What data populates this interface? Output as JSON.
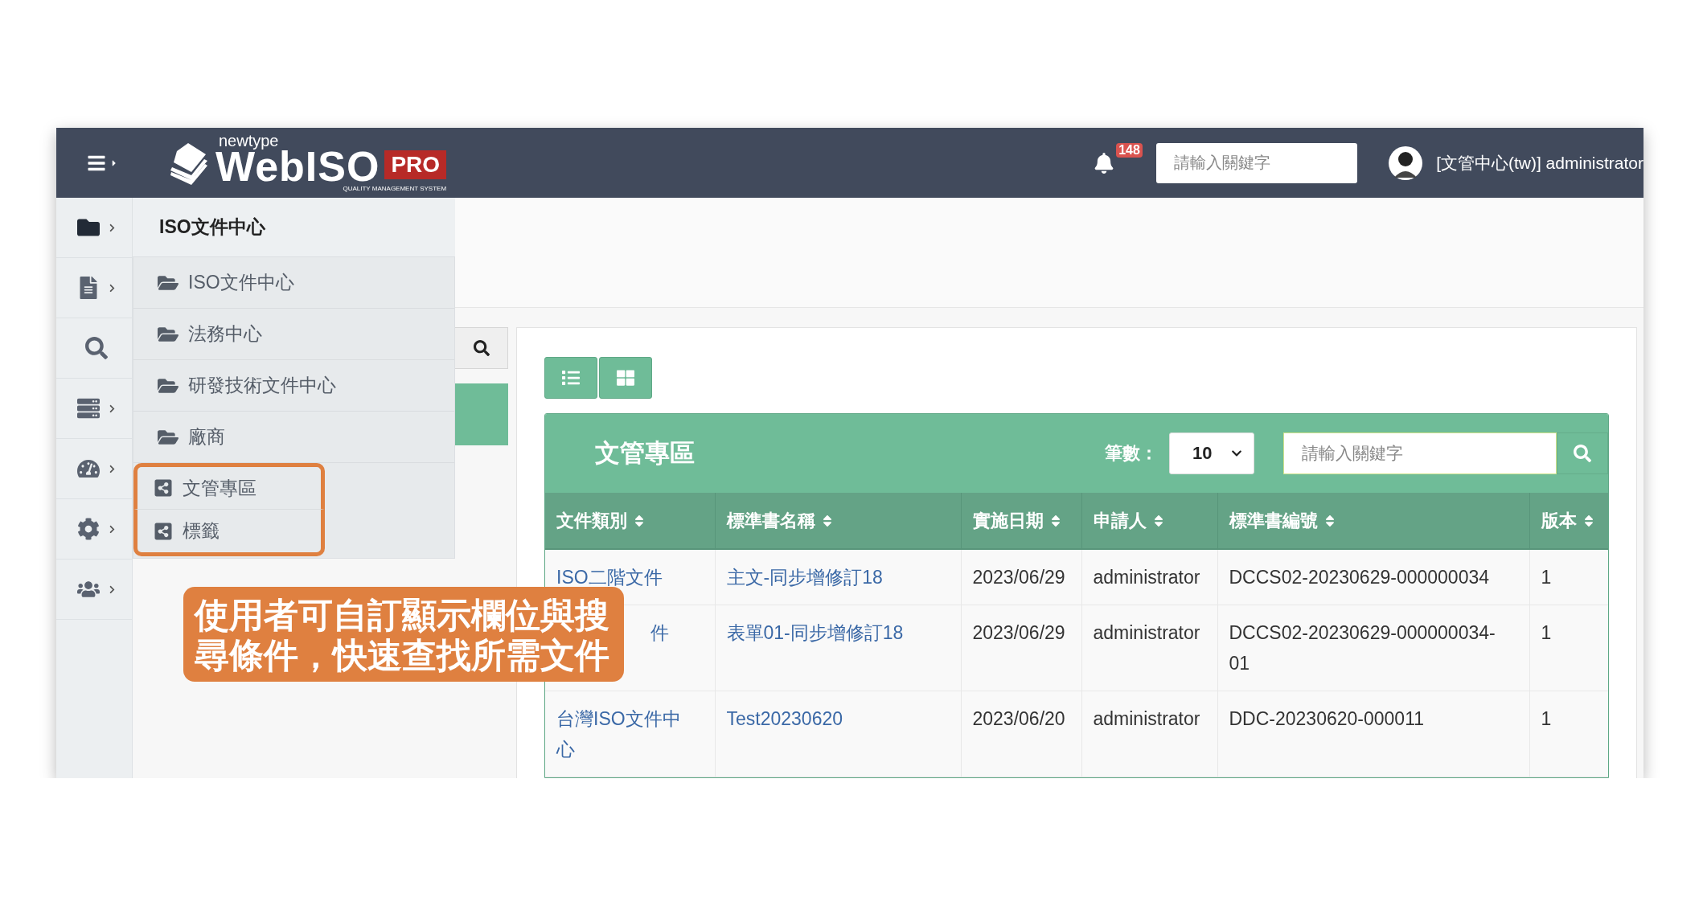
{
  "logo": {
    "small": "newtype",
    "main": "WebISO",
    "badge": "PRO",
    "tagline": "QUALITY MANAGEMENT SYSTEM"
  },
  "notifications": {
    "count": "148"
  },
  "search": {
    "placeholder": "請輸入關鍵字"
  },
  "user": {
    "label": "[文管中心(tw)] administrator"
  },
  "rail": [
    {
      "kind": "folder",
      "chevron": true,
      "selected": true
    },
    {
      "kind": "file",
      "chevron": true,
      "selected": false
    },
    {
      "kind": "search",
      "chevron": false,
      "selected": false
    },
    {
      "kind": "server",
      "chevron": true,
      "selected": false
    },
    {
      "kind": "dashboard",
      "chevron": true,
      "selected": false
    },
    {
      "kind": "settings",
      "chevron": true,
      "selected": false
    },
    {
      "kind": "users",
      "chevron": true,
      "selected": false
    }
  ],
  "menu": {
    "title": "ISO文件中心",
    "items": [
      {
        "label": "ISO文件中心",
        "kind": "folder",
        "highlighted": false
      },
      {
        "label": "法務中心",
        "kind": "folder",
        "highlighted": false
      },
      {
        "label": "研發技術文件中心",
        "kind": "folder",
        "highlighted": false
      },
      {
        "label": "廠商",
        "kind": "folder",
        "highlighted": false
      },
      {
        "label": "文管專區",
        "kind": "share",
        "highlighted": true
      },
      {
        "label": "標籤",
        "kind": "share",
        "highlighted": true
      }
    ]
  },
  "callout": {
    "text": "使用者可自訂顯示欄位與搜尋條件，快速查找所需文件"
  },
  "view_buttons": [
    {
      "kind": "list"
    },
    {
      "kind": "grid"
    }
  ],
  "panel": {
    "title": "文管專區",
    "count_label": "筆數：",
    "page_size": "10",
    "search_placeholder": "請輸入關鍵字"
  },
  "table": {
    "columns": [
      {
        "label": "文件類別",
        "kind": "link"
      },
      {
        "label": "標準書名稱",
        "kind": "link"
      },
      {
        "label": "實施日期",
        "kind": "text"
      },
      {
        "label": "申請人",
        "kind": "text"
      },
      {
        "label": "標準書編號",
        "kind": "text"
      },
      {
        "label": "版本",
        "kind": "text"
      }
    ],
    "rows": [
      {
        "cells": [
          {
            "text": "ISO二階文件",
            "partly_hidden": false
          },
          {
            "text": "主文-同步增修訂18",
            "partly_hidden": false
          },
          {
            "text": "2023/06/29",
            "partly_hidden": false
          },
          {
            "text": "administrator",
            "partly_hidden": false
          },
          {
            "text": "DCCS02-20230629-000000034",
            "partly_hidden": false
          },
          {
            "text": "1",
            "partly_hidden": false
          }
        ]
      },
      {
        "cells": [
          {
            "text": "件",
            "partly_hidden": true
          },
          {
            "text": "表單01-同步增修訂18",
            "partly_hidden": false
          },
          {
            "text": "2023/06/29",
            "partly_hidden": false
          },
          {
            "text": "administrator",
            "partly_hidden": false
          },
          {
            "text": "DCCS02-20230629-000000034-01",
            "partly_hidden": false
          },
          {
            "text": "1",
            "partly_hidden": false
          }
        ]
      },
      {
        "cells": [
          {
            "text": "台灣ISO文件中心",
            "partly_hidden": false
          },
          {
            "text": "Test20230620",
            "partly_hidden": false
          },
          {
            "text": "2023/06/20",
            "partly_hidden": false
          },
          {
            "text": "administrator",
            "partly_hidden": false
          },
          {
            "text": "DDC-20230620-000011",
            "partly_hidden": false
          },
          {
            "text": "1",
            "partly_hidden": false
          }
        ]
      }
    ]
  }
}
